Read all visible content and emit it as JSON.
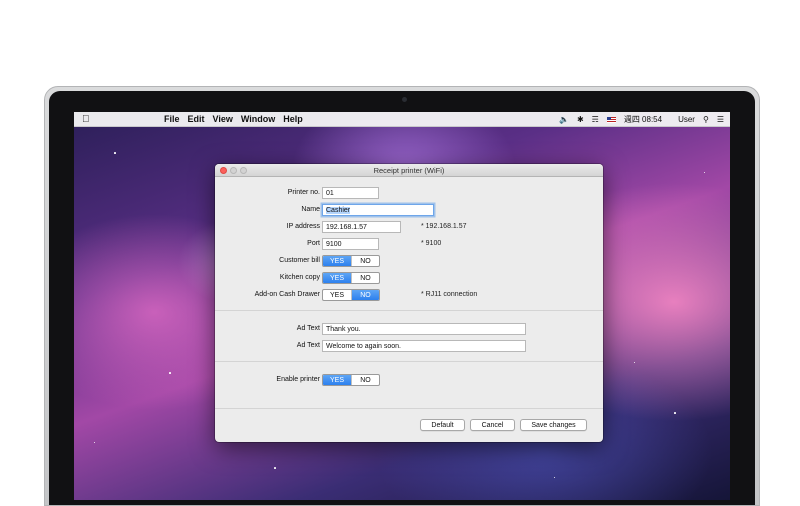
{
  "menubar": {
    "apple_icon": "apple-icon",
    "items": [
      "File",
      "Edit",
      "View",
      "Window",
      "Help"
    ],
    "status": {
      "clock": "週四 08:54",
      "user": "User"
    }
  },
  "window": {
    "title": "Receipt printer (WiFi)",
    "fields": {
      "printer_no": {
        "label": "Printer no.",
        "value": "01"
      },
      "name": {
        "label": "Name",
        "value": "Cashier"
      },
      "ip_address": {
        "label": "IP address",
        "value": "192.168.1.57",
        "hint": "* 192.168.1.57"
      },
      "port": {
        "label": "Port",
        "value": "9100",
        "hint": "* 9100"
      }
    },
    "toggles": {
      "customer_bill": {
        "label": "Customer bill",
        "yes": "YES",
        "no": "NO",
        "selected": "YES"
      },
      "kitchen_copy": {
        "label": "Kitchen copy",
        "yes": "YES",
        "no": "NO",
        "selected": "YES"
      },
      "cash_drawer": {
        "label": "Add-on Cash Drawer",
        "yes": "YES",
        "no": "NO",
        "selected": "NO",
        "hint": "* RJ11 connection"
      }
    },
    "ad_texts": [
      {
        "label": "Ad Text",
        "value": "Thank you."
      },
      {
        "label": "Ad Text",
        "value": "Welcome to again soon."
      }
    ],
    "enable_printer": {
      "label": "Enable printer",
      "yes": "YES",
      "no": "NO",
      "selected": "YES"
    },
    "buttons": {
      "default": "Default",
      "cancel": "Cancel",
      "save": "Save changes"
    }
  },
  "colors": {
    "accent": "#2d80ee",
    "close_button": "#fc605c"
  }
}
